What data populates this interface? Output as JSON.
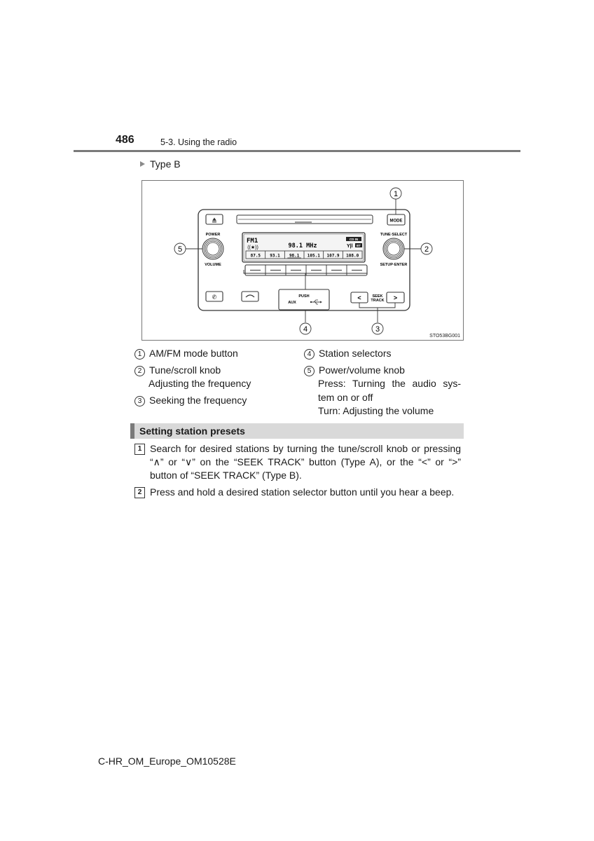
{
  "header": {
    "page_number": "486",
    "section": "5-3. Using the radio"
  },
  "type_label": "Type B",
  "figure": {
    "code": "STO53BG001",
    "radio": {
      "mode_button": "MODE",
      "eject_icon": "eject-icon",
      "power_label": "POWER",
      "volume_label": "VOLUME",
      "tune_label": "TUNE·SELECT",
      "setup_label": "SETUP·ENTER",
      "display": {
        "band": "FM1",
        "frequency": "98.1  MHz",
        "cd_in": "CD IN",
        "bt": "BT",
        "presets": [
          "87.5",
          "93.1",
          "98.1",
          "105.1",
          "107.9",
          "108.0"
        ],
        "selected_preset": 2
      },
      "station_buttons": [
        "—",
        "—",
        "—",
        "—",
        "—",
        "—"
      ],
      "phone_icon": "phone-pickup-icon",
      "hangup_icon": "phone-hangup-icon",
      "push_label": "PUSH",
      "aux_label": "AUX",
      "usb_icon": "usb-icon",
      "seek_label_1": "SEEK",
      "seek_label_2": "TRACK",
      "seek_prev": "<",
      "seek_next": ">"
    },
    "callouts": [
      "1",
      "2",
      "3",
      "4",
      "5"
    ]
  },
  "legend": {
    "left": [
      {
        "num": "1",
        "lines": [
          "AM/FM mode button"
        ]
      },
      {
        "num": "2",
        "lines": [
          "Tune/scroll knob",
          "Adjusting the frequency"
        ]
      },
      {
        "num": "3",
        "lines": [
          "Seeking the frequency"
        ]
      }
    ],
    "right": [
      {
        "num": "4",
        "lines": [
          "Station selectors"
        ]
      },
      {
        "num": "5",
        "lines": [
          "Power/volume knob",
          "Press: Turning the audio sys-",
          "tem on or off",
          "Turn: Adjusting the volume"
        ]
      }
    ]
  },
  "section_title": "Setting station presets",
  "steps": [
    {
      "num": "1",
      "text": "Search for desired stations by turning the tune/scroll knob or pressing “∧” or “∨” on the “SEEK TRACK” button (Type A), or the “<” or “>” button of “SEEK TRACK” (Type B)."
    },
    {
      "num": "2",
      "text": "Press and hold a desired station selector button until you hear a beep."
    }
  ],
  "footer": {
    "code": "C-HR_OM_Europe_OM10528E"
  }
}
